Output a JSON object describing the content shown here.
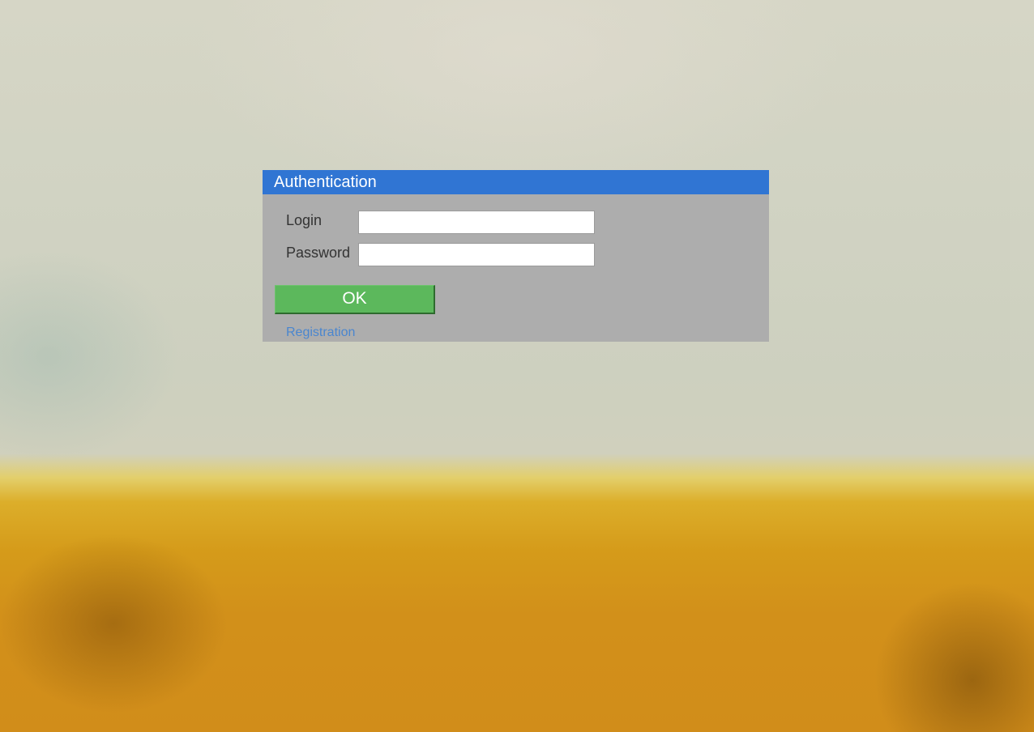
{
  "dialog": {
    "title": "Authentication",
    "login_label": "Login",
    "login_value": "",
    "password_label": "Password",
    "password_value": "",
    "ok_label": "OK",
    "registration_label": "Registration"
  },
  "colors": {
    "header": "#3075d3",
    "panel": "#adadad",
    "ok_button": "#5cb85c",
    "link": "#4a86cf"
  }
}
